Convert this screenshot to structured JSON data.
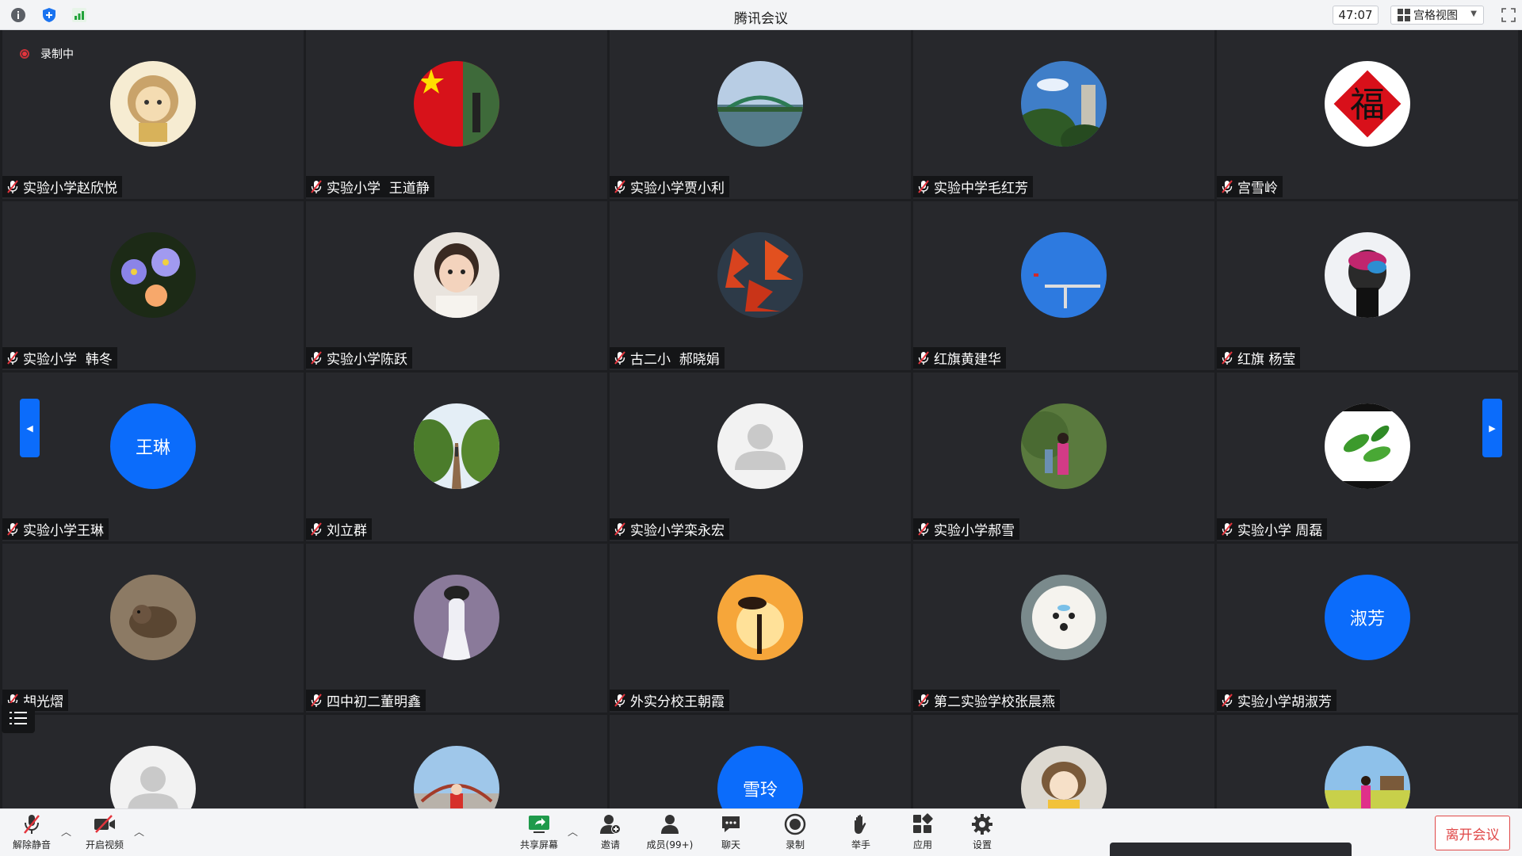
{
  "app": {
    "title": "腾讯会议",
    "timer": "47:07",
    "view_mode": "宫格视图"
  },
  "recording": {
    "label": "录制中"
  },
  "participants": [
    {
      "name": "实验小学赵欣悦",
      "avatar": "photo-lion-cartoon",
      "muted": true
    },
    {
      "name": "实验小学  王道静",
      "avatar": "photo-flag",
      "muted": true
    },
    {
      "name": "实验小学贾小利",
      "avatar": "photo-bridge",
      "muted": true
    },
    {
      "name": "实验中学毛红芳",
      "avatar": "photo-trees-sky",
      "muted": true
    },
    {
      "name": "宫雪岭",
      "avatar": "photo-fu-character",
      "muted": true
    },
    {
      "name": "实验小学  韩冬",
      "avatar": "photo-flowers",
      "muted": true
    },
    {
      "name": "实验小学陈跃",
      "avatar": "photo-child",
      "muted": true
    },
    {
      "name": "古二小  郝晓娟",
      "avatar": "photo-red-leaves",
      "muted": true
    },
    {
      "name": "红旗黄建华",
      "avatar": "photo-blue-sky",
      "muted": true
    },
    {
      "name": "红旗 杨莹",
      "avatar": "photo-woman-scarf",
      "muted": true
    },
    {
      "name": "实验小学王琳",
      "avatar_text": "王琳",
      "muted": true
    },
    {
      "name": "刘立群",
      "avatar": "photo-path",
      "muted": true
    },
    {
      "name": "实验小学栾永宏",
      "avatar": "default-user",
      "muted": true
    },
    {
      "name": "实验小学郝雪",
      "avatar": "photo-garden",
      "muted": true
    },
    {
      "name": "实验小学 周磊",
      "avatar": "photo-leaves",
      "muted": true
    },
    {
      "name": "胡光熠",
      "avatar": "photo-squirrel",
      "muted": true
    },
    {
      "name": "四中初二董明鑫",
      "avatar": "photo-woman-white",
      "muted": true
    },
    {
      "name": "外实分校王朝霞",
      "avatar": "photo-sunset",
      "muted": true
    },
    {
      "name": "第二实验学校张晨燕",
      "avatar": "photo-dog",
      "muted": true
    },
    {
      "name": "实验小学胡淑芳",
      "avatar_text": "淑芳",
      "muted": true
    },
    {
      "name": "",
      "avatar": "default-user",
      "muted": true
    },
    {
      "name": "",
      "avatar": "photo-stadium",
      "muted": true
    },
    {
      "name": "",
      "avatar_text": "雪玲",
      "muted": true
    },
    {
      "name": "",
      "avatar": "photo-girl-cartoon",
      "muted": true
    },
    {
      "name": "",
      "avatar": "photo-field",
      "muted": true
    }
  ],
  "toolbar": {
    "unmute": "解除静音",
    "start_video": "开启视频",
    "share_screen": "共享屏幕",
    "invite": "邀请",
    "members": "成员(99+)",
    "chat": "聊天",
    "record": "录制",
    "raise_hand": "举手",
    "apps": "应用",
    "settings": "设置",
    "leave": "离开会议"
  },
  "colors": {
    "accent": "#0b6cfb",
    "tile_bg": "#27282c",
    "leave": "#e04848",
    "mute_red": "#e4353d"
  }
}
